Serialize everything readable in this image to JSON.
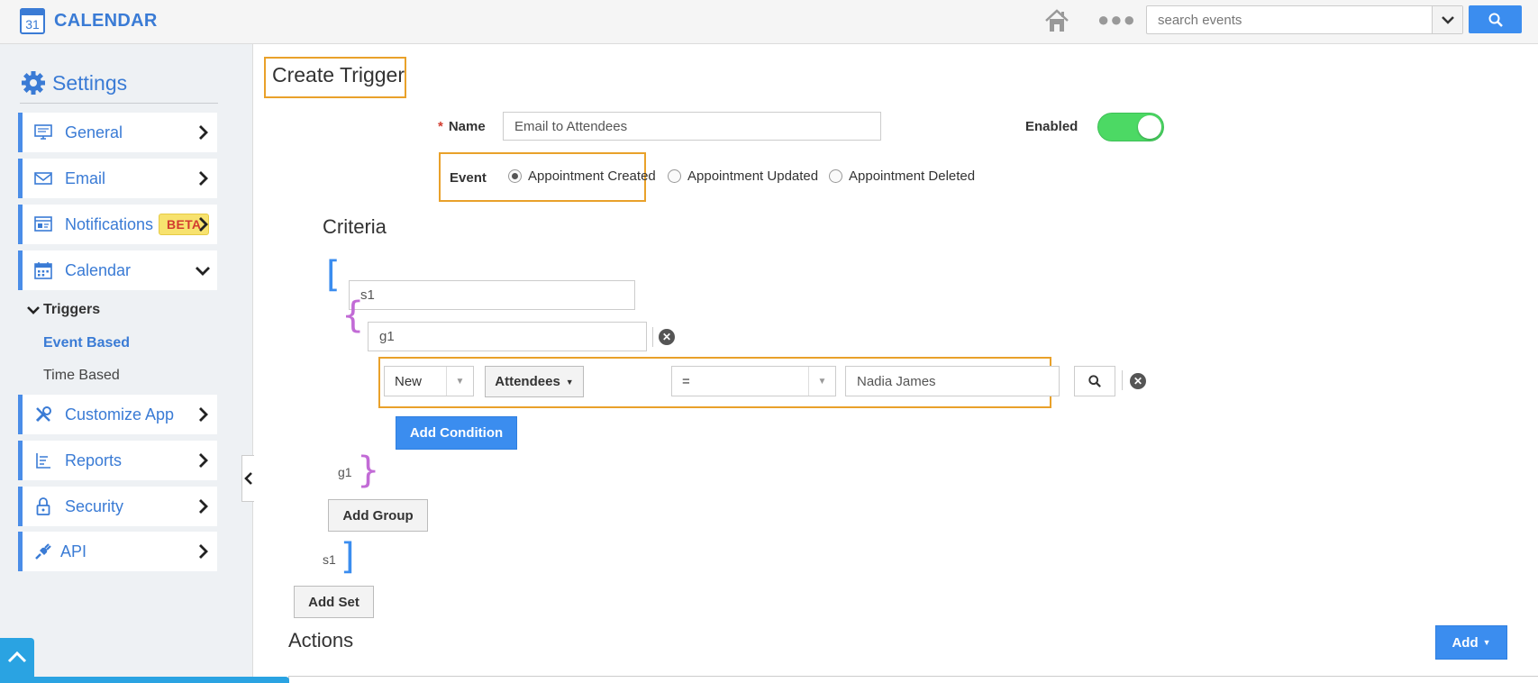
{
  "app": {
    "title": "CALENDAR",
    "icon_day": "31"
  },
  "topbar": {
    "search_placeholder": "search events",
    "icons": [
      "home-icon",
      "more-icon",
      "chevron-down-icon",
      "search-icon"
    ]
  },
  "sidebar": {
    "heading": "Settings",
    "items": [
      {
        "label": "General",
        "icon": "monitor-icon"
      },
      {
        "label": "Email",
        "icon": "envelope-icon"
      },
      {
        "label": "Notifications",
        "icon": "notification-icon",
        "badge": "BETA"
      },
      {
        "label": "Calendar",
        "icon": "calendar-icon"
      },
      {
        "label": "Customize App",
        "icon": "tools-icon"
      },
      {
        "label": "Reports",
        "icon": "reports-icon"
      },
      {
        "label": "Security",
        "icon": "lock-icon"
      },
      {
        "label": "API",
        "icon": "plug-icon"
      }
    ],
    "tree": {
      "heading": "Triggers",
      "children": [
        "Event Based",
        "Time Based"
      ]
    }
  },
  "form": {
    "page_title": "Create Trigger",
    "name_label": "Name",
    "name_required_mark": "*",
    "name_value": "Email to Attendees",
    "enabled_label": "Enabled",
    "enabled": true,
    "event_label": "Event",
    "event_options": [
      "Appointment Created",
      "Appointment Updated",
      "Appointment Deleted"
    ],
    "event_selected": "Appointment Created"
  },
  "criteria": {
    "title": "Criteria",
    "set_name": "s1",
    "group_name": "g1",
    "set_open": "[",
    "set_close": "]",
    "group_open": "{",
    "group_close": "}",
    "condition": {
      "state": "New",
      "field": "Attendees",
      "operator": "=",
      "value": "Nadia James"
    },
    "add_condition": "Add Condition",
    "add_group": "Add Group",
    "add_set": "Add Set",
    "group_end_label": "g1",
    "set_end_label": "s1"
  },
  "actions": {
    "title": "Actions",
    "add_label": "Add"
  },
  "colors": {
    "accent": "#3b8def",
    "highlight": "#e9a12a",
    "toggle_on": "#4cd964",
    "set_bracket": "#3b8def",
    "group_bracket": "#c26bd6"
  }
}
